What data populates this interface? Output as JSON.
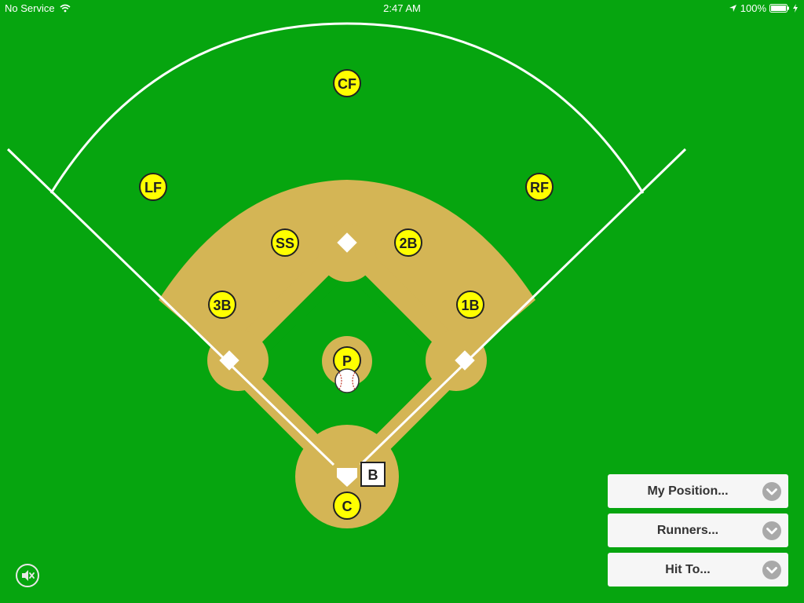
{
  "status_bar": {
    "carrier": "No Service",
    "time": "2:47 AM",
    "battery": "100%"
  },
  "players": [
    {
      "label": "CF"
    },
    {
      "label": "LF"
    },
    {
      "label": "RF"
    },
    {
      "label": "SS"
    },
    {
      "label": "2B"
    },
    {
      "label": "3B"
    },
    {
      "label": "1B"
    },
    {
      "label": "P"
    },
    {
      "label": "C"
    }
  ],
  "batter_marker": "B",
  "menus": {
    "my_position": "My Position...",
    "runners": "Runners...",
    "hit_to": "Hit To..."
  },
  "colors": {
    "grass": "#06a50f",
    "dirt": "#d4b555",
    "player_fill": "#ffff00",
    "lines": "#ffffff"
  }
}
